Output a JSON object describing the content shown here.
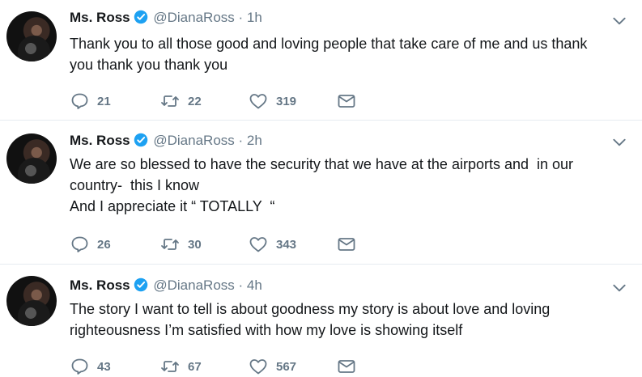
{
  "tweets": [
    {
      "name": "Ms. Ross",
      "handle": "@DianaRoss",
      "separator": "·",
      "time": "1h",
      "lines": [
        "Thank you to all those good and loving people that take care of me and us thank",
        "you thank you thank you"
      ],
      "replies": "21",
      "retweets": "22",
      "likes": "319"
    },
    {
      "name": "Ms. Ross",
      "handle": "@DianaRoss",
      "separator": "·",
      "time": "2h",
      "lines": [
        "We are so blessed to have the security that we have at the airports and  in our",
        "country-  this I know",
        "And I appreciate it “ TOTALLY  “"
      ],
      "replies": "26",
      "retweets": "30",
      "likes": "343"
    },
    {
      "name": "Ms. Ross",
      "handle": "@DianaRoss",
      "separator": "·",
      "time": "4h",
      "lines": [
        "The story I want to tell is about goodness my story is about love and loving",
        "righteousness I’m satisfied with how my love is showing itself"
      ],
      "replies": "43",
      "retweets": "67",
      "likes": "567"
    }
  ],
  "icons": {
    "verified": "verified-badge-icon",
    "caret": "chevron-down-icon",
    "reply": "reply-icon",
    "retweet": "retweet-icon",
    "like": "heart-icon",
    "message": "envelope-icon"
  },
  "colors": {
    "text": "#14171a",
    "secondary": "#657786",
    "verified": "#1da1f2",
    "divider": "#e6ecf0"
  }
}
